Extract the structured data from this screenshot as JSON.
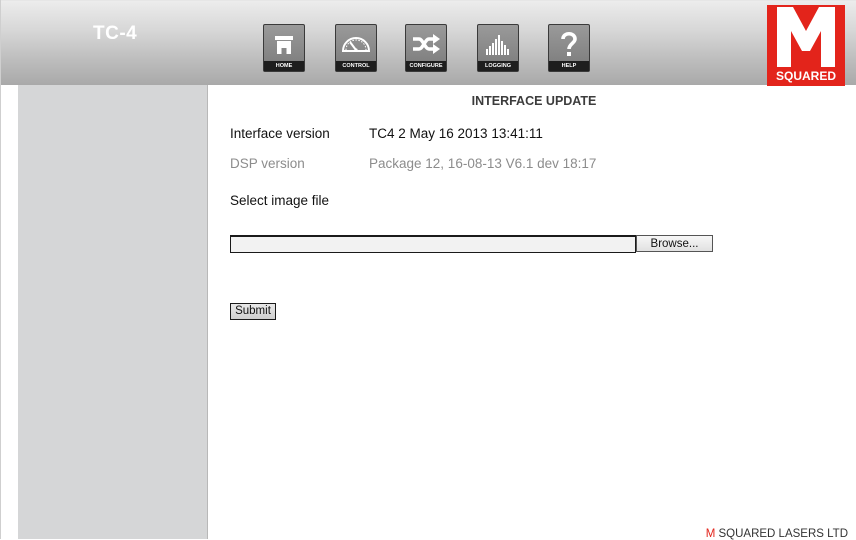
{
  "header": {
    "title": "TC-4",
    "nav": [
      {
        "label": "HOME",
        "icon": "home-icon"
      },
      {
        "label": "CONTROL",
        "icon": "gauge-icon"
      },
      {
        "label": "CONFIGURE",
        "icon": "shuffle-icon"
      },
      {
        "label": "LOGGING",
        "icon": "bar-chart-icon"
      },
      {
        "label": "HELP",
        "icon": "help-icon"
      }
    ],
    "logo": {
      "letter": "M",
      "text": "SQUARED",
      "color": "#e3241b"
    }
  },
  "main": {
    "title": "INTERFACE UPDATE",
    "interface_version_label": "Interface version",
    "interface_version_value": "TC4 2 May 16 2013 13:41:11",
    "dsp_version_label": "DSP version",
    "dsp_version_value": "Package 12, 16-08-13 V6.1 dev 18:17",
    "select_label": "Select image file",
    "file_value": "",
    "browse_label": "Browse...",
    "submit_label": "Submit"
  },
  "footer": {
    "prefix": "M",
    "text": "SQUARED LASERS LTD"
  }
}
